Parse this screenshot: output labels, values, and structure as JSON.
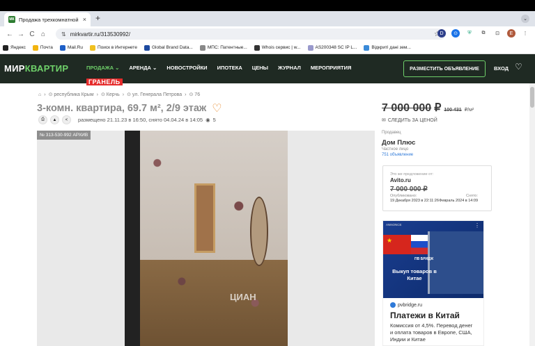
{
  "browser": {
    "tab_title": "Продажа трехкомнатной кв",
    "tab_close": "×",
    "new_tab": "+",
    "favicon": "МК",
    "url": "mirkvartir.ru/313530992/",
    "nav_icons": {
      "back": "←",
      "forward": "→",
      "reload": "C",
      "home": "⌂"
    },
    "site_info": "⇅",
    "bookmark_star": "☆",
    "ext_icons": [
      "D",
      "⊙",
      "⛨",
      "⧉",
      "⊡",
      "E",
      "⋮"
    ],
    "tab_chevron": "⌄"
  },
  "bookmarks": [
    {
      "label": "Яндекс",
      "color": "#222"
    },
    {
      "label": "Почта",
      "color": "#f2b40f"
    },
    {
      "label": "Mail.Ru",
      "color": "#1e5fc7"
    },
    {
      "label": "Поиск в Интернете",
      "color": "#f0c020"
    },
    {
      "label": "Global Brand Data...",
      "color": "#1e4aa0"
    },
    {
      "label": "МПС: Патентные...",
      "color": "#888"
    },
    {
      "label": "Whois сервис | w...",
      "color": "#333"
    },
    {
      "label": "AS200348 SC IP L...",
      "color": "#99c"
    },
    {
      "label": "Відкриті дані зем...",
      "color": "#3a8ad8"
    }
  ],
  "site": {
    "logo_a": "МИР",
    "logo_b": "КВАРТИР",
    "nav": [
      "ПРОДАЖА ⌄",
      "АРЕНДА ⌄",
      "НОВОСТРОЙКИ",
      "ИПОТЕКА",
      "ЦЕНЫ",
      "ЖУРНАЛ",
      "МЕРОПРИЯТИЯ"
    ],
    "promo": "ГРАНЕЛЬ",
    "place_ad": "РАЗМЕСТИТЬ ОБЪЯВЛЕНИЕ",
    "login": "ВХОД",
    "heart": "♡"
  },
  "listing": {
    "breadcrumbs": [
      "⌂",
      "›",
      "⊙ республика Крым",
      "›",
      "⊙ Керчь",
      "›",
      "⊙ ул. Генерала Петрова",
      "›",
      "⊙ 76"
    ],
    "title": "3-комн. квартира, 69.7 м², 2/9 этаж",
    "fav_icon": "♡",
    "tool_icons": [
      "⎙",
      "▲",
      "<"
    ],
    "meta": "размещено 21.11.23 в 16:50, снято 04.04.24 в 14:05",
    "views_icon": "◉",
    "views": "5",
    "photo_tag": "№ 313-530-992  АРХИВ",
    "watermark": "ЦИАН"
  },
  "sidebar": {
    "price": "7 000 000",
    "currency": "₽",
    "price_per_m": "100 431",
    "price_unit": "₽/м²",
    "follow_icon": "✉",
    "follow": "СЛЕДИТЬ ЗА ЦЕНОЙ",
    "seller_label": "Продавец",
    "seller": "Дом Плюс",
    "seller_type": "Частное лицо",
    "seller_count": "751 объявление",
    "avito": {
      "caption": "Это же предложение от:",
      "source": "Avito.ru",
      "price": "7 000 000 ₽",
      "published_label": "Опубликовано:",
      "removed_label": "Снято:",
      "published": "19 Декабря 2023 в 22:11:26",
      "removed": "Февраль 2024 в 14:09"
    }
  },
  "ad": {
    "label": "ANNONCE",
    "menu": "⋮",
    "brand": "ПВ БРИДЖ",
    "banner_text": "Выкуп товаров в Китае",
    "site": "pvbridge.ru",
    "headline": "Платежи в Китай",
    "body": "Комиссия от 4,5%. Перевод денег и оплата товаров в Европе, США, Индии и Китае"
  }
}
